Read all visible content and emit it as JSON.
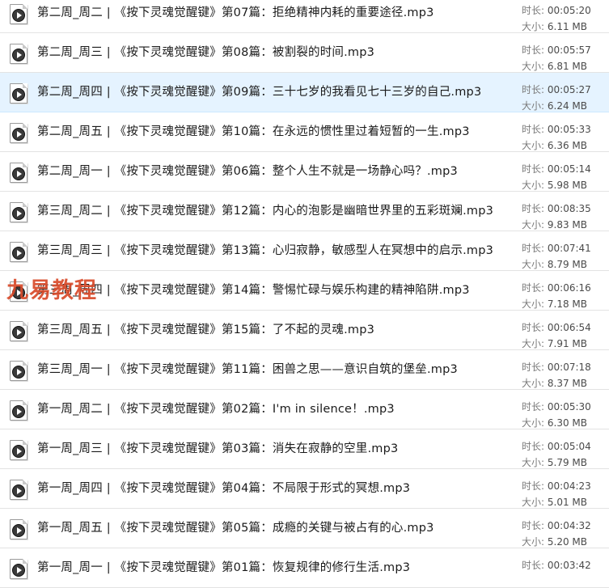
{
  "meta_labels": {
    "duration": "时长:",
    "size": "大小:"
  },
  "watermark": "九易教程",
  "files": [
    {
      "name": "第二周_周二 | 《按下灵魂觉醒键》第07篇：拒绝精神内耗的重要途径.mp3",
      "duration": "00:05:20",
      "size": "6.11 MB",
      "selected": false
    },
    {
      "name": "第二周_周三 | 《按下灵魂觉醒键》第08篇：被割裂的时间.mp3",
      "duration": "00:05:57",
      "size": "6.81 MB",
      "selected": false
    },
    {
      "name": "第二周_周四 | 《按下灵魂觉醒键》第09篇：三十七岁的我看见七十三岁的自己.mp3",
      "duration": "00:05:27",
      "size": "6.24 MB",
      "selected": true
    },
    {
      "name": "第二周_周五 | 《按下灵魂觉醒键》第10篇：在永远的惯性里过着短暂的一生.mp3",
      "duration": "00:05:33",
      "size": "6.36 MB",
      "selected": false
    },
    {
      "name": "第二周_周一 | 《按下灵魂觉醒键》第06篇：整个人生不就是一场静心吗？.mp3",
      "duration": "00:05:14",
      "size": "5.98 MB",
      "selected": false
    },
    {
      "name": "第三周_周二 | 《按下灵魂觉醒键》第12篇：内心的泡影是幽暗世界里的五彩斑斓.mp3",
      "duration": "00:08:35",
      "size": "9.83 MB",
      "selected": false
    },
    {
      "name": "第三周_周三 | 《按下灵魂觉醒键》第13篇：心归寂静，敏感型人在冥想中的启示.mp3",
      "duration": "00:07:41",
      "size": "8.79 MB",
      "selected": false
    },
    {
      "name": "第三周_周四 | 《按下灵魂觉醒键》第14篇：警惕忙碌与娱乐构建的精神陷阱.mp3",
      "duration": "00:06:16",
      "size": "7.18 MB",
      "selected": false
    },
    {
      "name": "第三周_周五 | 《按下灵魂觉醒键》第15篇：了不起的灵魂.mp3",
      "duration": "00:06:54",
      "size": "7.91 MB",
      "selected": false
    },
    {
      "name": "第三周_周一 | 《按下灵魂觉醒键》第11篇：困兽之思——意识自筑的堡垒.mp3",
      "duration": "00:07:18",
      "size": "8.37 MB",
      "selected": false
    },
    {
      "name": "第一周_周二 | 《按下灵魂觉醒键》第02篇：I'm in silence！.mp3",
      "duration": "00:05:30",
      "size": "6.30 MB",
      "selected": false
    },
    {
      "name": "第一周_周三 | 《按下灵魂觉醒键》第03篇：消失在寂静的空里.mp3",
      "duration": "00:05:04",
      "size": "5.79 MB",
      "selected": false
    },
    {
      "name": "第一周_周四 | 《按下灵魂觉醒键》第04篇：不局限于形式的冥想.mp3",
      "duration": "00:04:23",
      "size": "5.01 MB",
      "selected": false
    },
    {
      "name": "第一周_周五 | 《按下灵魂觉醒键》第05篇：成瘾的关键与被占有的心.mp3",
      "duration": "00:04:32",
      "size": "5.20 MB",
      "selected": false
    },
    {
      "name": "第一周_周一 | 《按下灵魂觉醒键》第01篇：恢复规律的修行生活.mp3",
      "duration": "00:03:42",
      "size": "",
      "selected": false
    }
  ]
}
